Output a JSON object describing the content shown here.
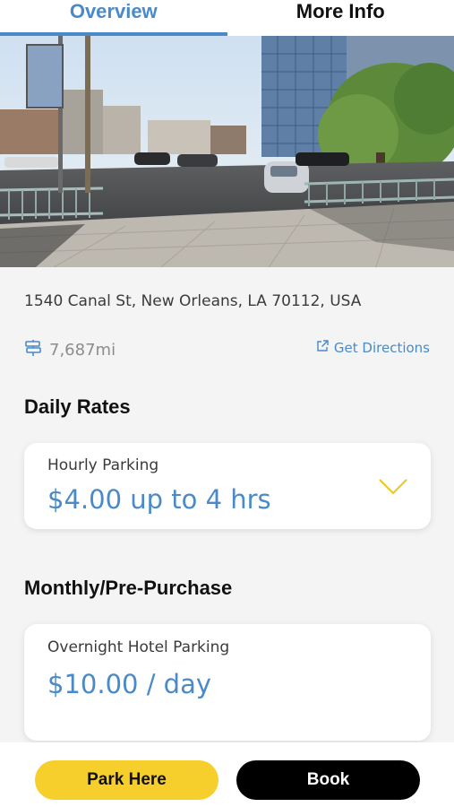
{
  "tabs": [
    {
      "label": "Overview",
      "active": true
    },
    {
      "label": "More Info",
      "active": false
    }
  ],
  "location": {
    "address": "1540 Canal St, New Orleans, LA 70112, USA",
    "distance": "7,687mi",
    "directions_label": "Get Directions"
  },
  "daily_rates": {
    "title": "Daily Rates",
    "card": {
      "label": "Hourly Parking",
      "price": "$4.00 up to 4 hrs"
    }
  },
  "monthly": {
    "title": "Monthly/Pre-Purchase",
    "card": {
      "label": "Overnight Hotel Parking",
      "price": "$10.00 / day"
    }
  },
  "actions": {
    "park_here": "Park Here",
    "book": "Book"
  },
  "colors": {
    "accent": "#4a8ac9",
    "park_button": "#f7cf2c",
    "book_button": "#000000"
  },
  "icons": {
    "distance": "signpost-icon",
    "directions": "external-link-icon",
    "expand": "chevron-down-icon"
  }
}
